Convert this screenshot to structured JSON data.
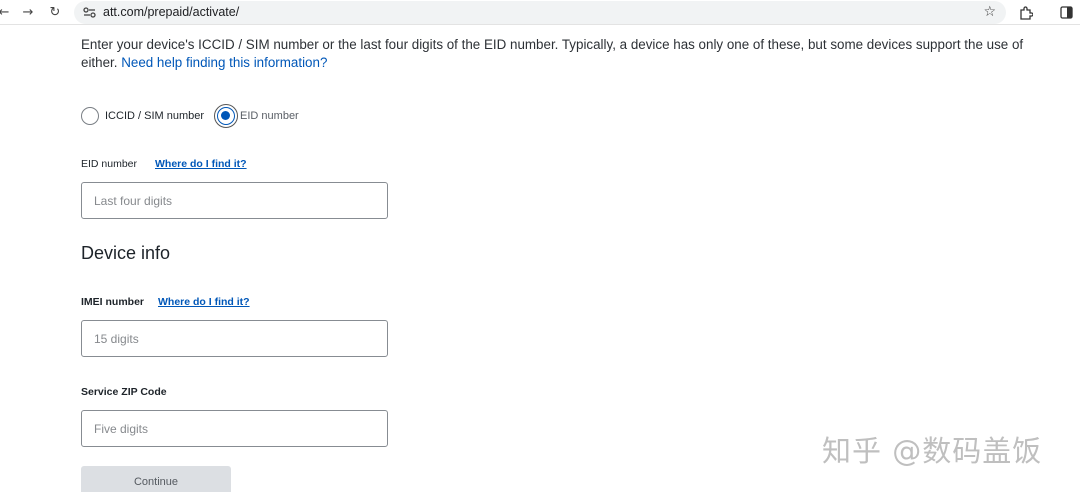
{
  "browser": {
    "url": "att.com/prepaid/activate/"
  },
  "intro": {
    "text": "Enter your device's ICCID / SIM number or the last four digits of the EID number. Typically, a device has only one of these, but some devices support the use of either. ",
    "help_link": "Need help finding this information?"
  },
  "id_type": {
    "options": [
      {
        "label": "ICCID / SIM number",
        "selected": false
      },
      {
        "label": "EID number",
        "selected": true
      }
    ]
  },
  "eid_field": {
    "label": "EID number",
    "help_link": "Where do I find it?",
    "placeholder": "Last four digits",
    "value": ""
  },
  "device_info": {
    "title": "Device info"
  },
  "imei_field": {
    "label": "IMEI number",
    "help_link": "Where do I find it?",
    "placeholder": "15 digits",
    "value": ""
  },
  "zip_field": {
    "label": "Service ZIP Code",
    "placeholder": "Five digits",
    "value": ""
  },
  "continue_button": {
    "label": "Continue"
  },
  "watermark": {
    "text": "知乎 @数码盖饭"
  },
  "colors": {
    "accent": "#0057b8",
    "text": "#1d2329",
    "button_disabled_bg": "#dcdfe3"
  }
}
